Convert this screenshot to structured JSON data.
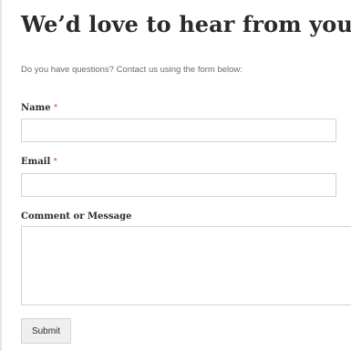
{
  "header": {
    "title": "We’d love to hear from you",
    "intro": "Do you have questions? Contact us using the form below:"
  },
  "form": {
    "name": {
      "label": "Name",
      "required_marker": "*",
      "value": ""
    },
    "email": {
      "label": "Email",
      "required_marker": "*",
      "value": ""
    },
    "message": {
      "label": "Comment or Message",
      "value": ""
    },
    "submit_label": "Submit"
  },
  "colors": {
    "required_marker": "#d9382f",
    "text": "#2b2b2b",
    "muted_text": "#6b6b6b",
    "input_border": "#d3d3d3",
    "button_bg": "#efefef"
  }
}
